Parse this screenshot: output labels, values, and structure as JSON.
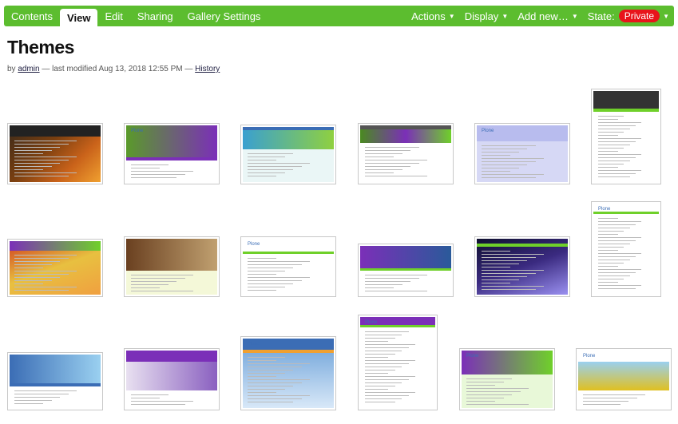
{
  "toolbar": {
    "tabs": [
      {
        "label": "Contents",
        "active": false
      },
      {
        "label": "View",
        "active": true
      },
      {
        "label": "Edit",
        "active": false
      },
      {
        "label": "Sharing",
        "active": false
      },
      {
        "label": "Gallery Settings",
        "active": false
      }
    ],
    "actions_label": "Actions",
    "display_label": "Display",
    "add_new_label": "Add new…",
    "state_label": "State:",
    "state_value": "Private",
    "caret": "▼"
  },
  "page": {
    "title": "Themes",
    "by": "by",
    "author": "admin",
    "modified_text": "— last modified Aug 13, 2018 12:55 PM —",
    "history_label": "History"
  },
  "gallery": {
    "count": 18,
    "logo_text": "Plone",
    "colors": {
      "toolbar": "#5cbd2f",
      "state_badge": "#e8141b",
      "plone_blue": "#3b6db5",
      "purple": "#7b2fb8",
      "lime": "#6fd02a"
    }
  }
}
